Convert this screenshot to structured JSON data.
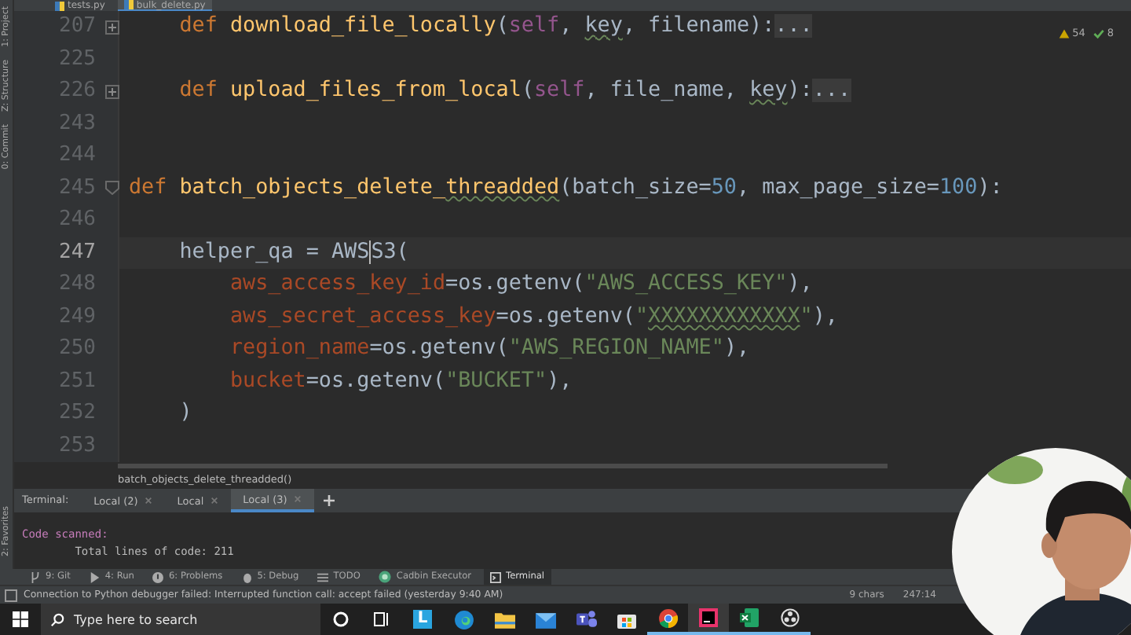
{
  "left_strip": [
    "1: Project",
    "Z: Structure",
    "0: Commit",
    "2: Favorites"
  ],
  "file_tabs": [
    {
      "label": "tests.py",
      "selected": false
    },
    {
      "label": "bulk_delete.py",
      "selected": true
    }
  ],
  "inspections": {
    "warnings": "54",
    "passed": "8"
  },
  "editor": {
    "lines": [
      {
        "number": "207",
        "current": false,
        "foldable": true,
        "collapsed": true,
        "tokens": [
          {
            "text": "    def ",
            "kind": "kw"
          },
          {
            "text": "download_file_locally",
            "kind": "fn"
          },
          {
            "text": "(",
            "kind": "plain"
          },
          {
            "text": "self",
            "kind": "self"
          },
          {
            "text": ", ",
            "kind": "plain"
          },
          {
            "text": "key",
            "kind": "plain",
            "underline": true
          },
          {
            "text": ", filename):",
            "kind": "plain"
          },
          {
            "text": "...",
            "kind": "fold"
          }
        ]
      },
      {
        "number": "225",
        "current": false,
        "foldable": false
      },
      {
        "number": "226",
        "current": false,
        "foldable": true,
        "collapsed": true,
        "tokens": [
          {
            "text": "    def ",
            "kind": "kw"
          },
          {
            "text": "upload_files_from_local",
            "kind": "fn"
          },
          {
            "text": "(",
            "kind": "plain"
          },
          {
            "text": "self",
            "kind": "self"
          },
          {
            "text": ", file_name, ",
            "kind": "plain"
          },
          {
            "text": "key",
            "kind": "plain",
            "underline": true
          },
          {
            "text": "):",
            "kind": "plain"
          },
          {
            "text": "...",
            "kind": "fold"
          }
        ]
      },
      {
        "number": "243",
        "current": false,
        "foldable": false
      },
      {
        "number": "244",
        "current": false,
        "foldable": false
      },
      {
        "number": "245",
        "current": false,
        "foldable": true,
        "collapsed": false,
        "tokens": [
          {
            "text": "def ",
            "kind": "kw"
          },
          {
            "text": "batch_objects_delete_",
            "kind": "fn"
          },
          {
            "text": "threadded",
            "kind": "fn",
            "underline": true
          },
          {
            "text": "(batch_size=",
            "kind": "plain"
          },
          {
            "text": "50",
            "kind": "num"
          },
          {
            "text": ", max_page_size=",
            "kind": "plain"
          },
          {
            "text": "100",
            "kind": "num"
          },
          {
            "text": "):",
            "kind": "plain"
          }
        ]
      },
      {
        "number": "246",
        "current": false,
        "foldable": false
      },
      {
        "number": "247",
        "current": true,
        "foldable": false,
        "tokens": [
          {
            "text": "    helper_qa = AWS",
            "kind": "plain",
            "caret": true
          },
          {
            "text": "S3(",
            "kind": "plain"
          }
        ]
      },
      {
        "number": "248",
        "current": false,
        "foldable": false,
        "tokens": [
          {
            "text": "        aws_access_key_id",
            "kind": "arg"
          },
          {
            "text": "=os.getenv(",
            "kind": "plain"
          },
          {
            "text": "\"AWS_ACCESS_KEY\"",
            "kind": "str"
          },
          {
            "text": "),",
            "kind": "plain"
          }
        ]
      },
      {
        "number": "249",
        "current": false,
        "foldable": false,
        "tokens": [
          {
            "text": "        aws_secret_access_key",
            "kind": "arg"
          },
          {
            "text": "=os.getenv(",
            "kind": "plain"
          },
          {
            "text": "\"",
            "kind": "str"
          },
          {
            "text": "XXXXXXXXXXXX",
            "kind": "str",
            "underline": true
          },
          {
            "text": "\"",
            "kind": "str"
          },
          {
            "text": "),",
            "kind": "plain"
          }
        ]
      },
      {
        "number": "250",
        "current": false,
        "foldable": false,
        "tokens": [
          {
            "text": "        region_name",
            "kind": "arg"
          },
          {
            "text": "=os.getenv(",
            "kind": "plain"
          },
          {
            "text": "\"AWS_REGION_NAME\"",
            "kind": "str"
          },
          {
            "text": "),",
            "kind": "plain"
          }
        ]
      },
      {
        "number": "251",
        "current": false,
        "foldable": false,
        "tokens": [
          {
            "text": "        bucket",
            "kind": "arg"
          },
          {
            "text": "=os.getenv(",
            "kind": "plain"
          },
          {
            "text": "\"BUCKET\"",
            "kind": "str"
          },
          {
            "text": "),",
            "kind": "plain"
          }
        ]
      },
      {
        "number": "252",
        "current": false,
        "foldable": false,
        "tokens": [
          {
            "text": "    )",
            "kind": "plain"
          }
        ]
      },
      {
        "number": "253",
        "current": false,
        "foldable": false
      }
    ]
  },
  "breadcrumb": "batch_objects_delete_threadded()",
  "terminal": {
    "title": "Terminal:",
    "tabs": [
      {
        "label": "Local (2)",
        "selected": false
      },
      {
        "label": "Local",
        "selected": false
      },
      {
        "label": "Local (3)",
        "selected": true
      }
    ],
    "output": [
      {
        "text": "Code scanned:",
        "kind": "heading"
      },
      {
        "text": "        Total lines of code: 211",
        "kind": "plain"
      }
    ]
  },
  "tool_buttons": [
    {
      "label": "9: Git",
      "kind": "git",
      "selected": false
    },
    {
      "label": "4: Run",
      "kind": "run",
      "selected": false
    },
    {
      "label": "6: Problems",
      "kind": "problems",
      "selected": false
    },
    {
      "label": "5: Debug",
      "kind": "debug",
      "selected": false
    },
    {
      "label": "TODO",
      "kind": "todo",
      "selected": false
    },
    {
      "label": "Cadbin Executor",
      "kind": "plugin",
      "selected": false
    },
    {
      "label": "Terminal",
      "kind": "terminal",
      "selected": true
    }
  ],
  "status_bar": {
    "message": "Connection to Python debugger failed: Interrupted function call: accept failed (yesterday 9:40 AM)",
    "chars": "9 chars",
    "position": "247:14"
  },
  "taskbar": {
    "search_placeholder": "Type here to search",
    "apps": [
      {
        "kind": "letter",
        "letter": "L",
        "running": false,
        "selected": false
      },
      {
        "kind": "edge",
        "running": false,
        "selected": false
      },
      {
        "kind": "folder",
        "running": false,
        "selected": false
      },
      {
        "kind": "mail",
        "running": false,
        "selected": false
      },
      {
        "kind": "teams",
        "running": false,
        "selected": false
      },
      {
        "kind": "store",
        "running": false,
        "selected": false
      },
      {
        "kind": "chrome",
        "running": true,
        "selected": false
      },
      {
        "kind": "ide",
        "running": true,
        "selected": true
      },
      {
        "kind": "excel",
        "running": true,
        "selected": false
      },
      {
        "kind": "obs",
        "running": true,
        "selected": false
      }
    ]
  }
}
